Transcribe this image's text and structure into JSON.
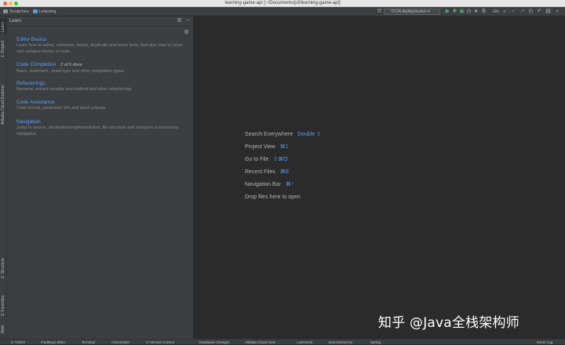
{
  "window": {
    "title": "learning-game-api [~/Documents/p3/learning-game-api]",
    "traffic_colors": [
      "#fc5f57",
      "#fdbc2e",
      "#33c748"
    ]
  },
  "navbar": {
    "breadcrumbs": [
      "Scratches",
      "Learning"
    ],
    "run_config": "DCALApiApplication",
    "vcs_label": "Git:"
  },
  "left_strip": {
    "tabs": [
      "Learn",
      "1: Project",
      "Alibaba Cloud Explorer",
      "Z: Structure",
      "2: Favorites",
      "Web"
    ]
  },
  "learn_panel": {
    "title": "Learn",
    "lessons": [
      {
        "title": "Editor Basics",
        "progress": "",
        "description": "Learn how to select, comment, delete, duplicate and move lines. And also how to move and collapse blocks of code."
      },
      {
        "title": "Code Completion",
        "progress": "2 of 5 done",
        "description": "Basic, statement, smart type and other completion types"
      },
      {
        "title": "Refactorings",
        "progress": "",
        "description": "Rename, extract variable and method and other refactorings"
      },
      {
        "title": "Code Assistance",
        "progress": "",
        "description": "Code format, parameter info and quick popups"
      },
      {
        "title": "Navigation",
        "progress": "",
        "description": "Jump to source, declaration/implementation, file structure and next/prev occurrences navigation"
      }
    ]
  },
  "editor_hints": [
    {
      "label": "Search Everywhere",
      "shortcut": "Double ⇧"
    },
    {
      "label": "Project View",
      "shortcut": "⌘1"
    },
    {
      "label": "Go to File",
      "shortcut": "⇧⌘O"
    },
    {
      "label": "Recent Files",
      "shortcut": "⌘E"
    },
    {
      "label": "Navigation Bar",
      "shortcut": "⌘↑"
    },
    {
      "label": "Drop files here to open",
      "shortcut": ""
    }
  ],
  "bottom_tabs": [
    "6: TODO",
    "FindBugs-IDEA",
    "Terminal",
    "CheckStyle",
    "0: Version Control",
    "Database Changes",
    "Alibaba Cloud View",
    "LuaCheck",
    "Java Enterprise",
    "Spring",
    "Event Log"
  ],
  "watermark": "知乎 @Java全栈架构师",
  "colors": {
    "link": "#589df6",
    "panel_bg": "#3c3f41",
    "editor_bg": "#2b2b2b"
  }
}
